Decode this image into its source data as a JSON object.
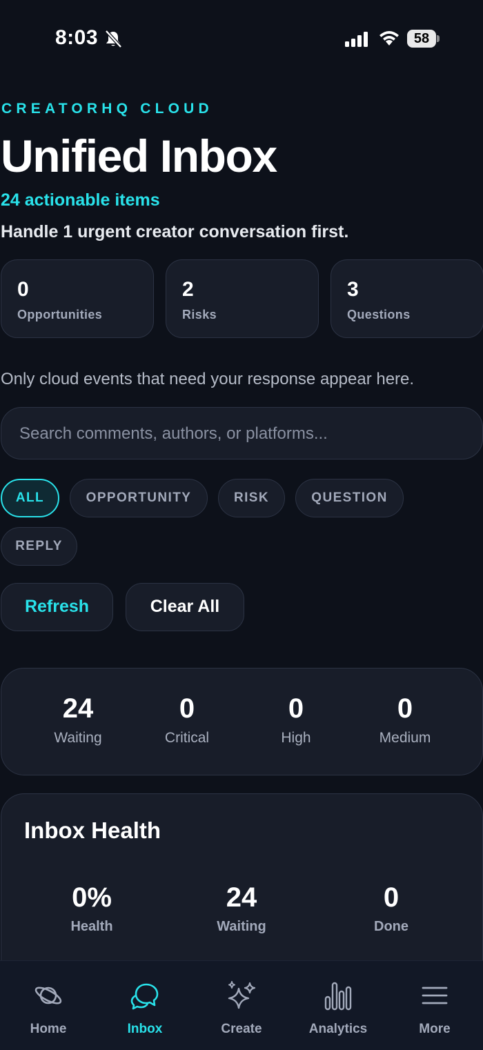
{
  "status_bar": {
    "time": "8:03",
    "battery": "58"
  },
  "brand": "CREATORHQ CLOUD",
  "title": "Unified Inbox",
  "actionable_count": "24 actionable items",
  "urgent_message": "Handle 1 urgent creator conversation first.",
  "stats": [
    {
      "value": "0",
      "label": "Opportunities"
    },
    {
      "value": "2",
      "label": "Risks"
    },
    {
      "value": "3",
      "label": "Questions"
    }
  ],
  "notice": "Only cloud events that need your response appear here.",
  "search": {
    "placeholder": "Search comments, authors, or platforms..."
  },
  "filters": [
    "ALL",
    "OPPORTUNITY",
    "RISK",
    "QUESTION",
    "REPLY"
  ],
  "active_filter": "ALL",
  "actions": {
    "refresh": "Refresh",
    "clear_all": "Clear All"
  },
  "summary": [
    {
      "value": "24",
      "label": "Waiting"
    },
    {
      "value": "0",
      "label": "Critical"
    },
    {
      "value": "0",
      "label": "High"
    },
    {
      "value": "0",
      "label": "Medium"
    }
  ],
  "health": {
    "title": "Inbox Health",
    "items": [
      {
        "value": "0%",
        "label": "Health"
      },
      {
        "value": "24",
        "label": "Waiting"
      },
      {
        "value": "0",
        "label": "Done"
      }
    ]
  },
  "tabs": [
    {
      "label": "Home",
      "icon": "planet-icon"
    },
    {
      "label": "Inbox",
      "icon": "chat-bubbles-icon"
    },
    {
      "label": "Create",
      "icon": "sparkles-icon"
    },
    {
      "label": "Analytics",
      "icon": "bar-chart-icon"
    },
    {
      "label": "More",
      "icon": "menu-icon"
    }
  ],
  "active_tab": "Inbox",
  "colors": {
    "accent": "#29e2ea",
    "background": "#0d111a",
    "card": "#181d29"
  }
}
